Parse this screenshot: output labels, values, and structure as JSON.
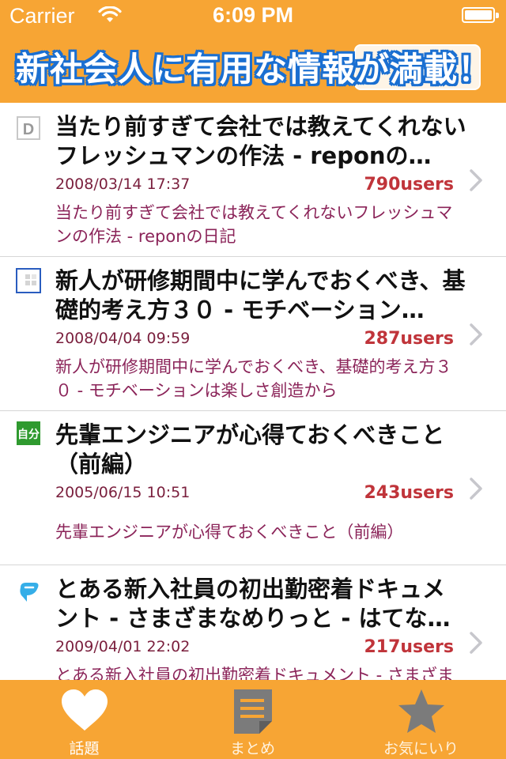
{
  "status_bar": {
    "carrier": "Carrier",
    "time": "6:09 PM"
  },
  "header": {
    "title": "新社会人に有用な情報が満載！"
  },
  "articles": [
    {
      "title": "当たり前すぎて会社では教えてくれないフレッシュマンの作法 - reponの…",
      "date": "2008/03/14 17:37",
      "users": "790users",
      "description": "当たり前すぎて会社では教えてくれないフレッシュマンの作法 - reponの日記",
      "icon": "d-favicon-icon"
    },
    {
      "title": "新人が研修期間中に学んでおくべき、基礎的考え方３０ - モチベーション…",
      "date": "2008/04/04 09:59",
      "users": "287users",
      "description": "新人が研修期間中に学んでおくべき、基礎的考え方３０ - モチベーションは楽しさ創造から",
      "icon": "grid-favicon-icon"
    },
    {
      "title": "先輩エンジニアが心得ておくべきこと（前編）",
      "date": "2005/06/15 10:51",
      "users": "243users",
      "description": "先輩エンジニアが心得ておくべきこと（前編）",
      "icon": "jibun-favicon-icon"
    },
    {
      "title": "とある新入社員の初出勤密着ドキュメント - さまざまなめりっと - はてな…",
      "date": "2009/04/01 22:02",
      "users": "217users",
      "description": "とある新入社員の初出勤密着ドキュメント - さまざまなめりっと - はてなダイアリー",
      "icon": "hatena-favicon-icon"
    }
  ],
  "tabs": [
    {
      "label": "話題",
      "icon": "heart-icon"
    },
    {
      "label": "まとめ",
      "icon": "document-icon"
    },
    {
      "label": "お気にいり",
      "icon": "star-icon"
    }
  ],
  "colors": {
    "accent": "#f7a534",
    "date": "#7a1f3d",
    "users": "#c0343a",
    "description": "#8b2459",
    "title_outline": "#1a6fd1"
  }
}
